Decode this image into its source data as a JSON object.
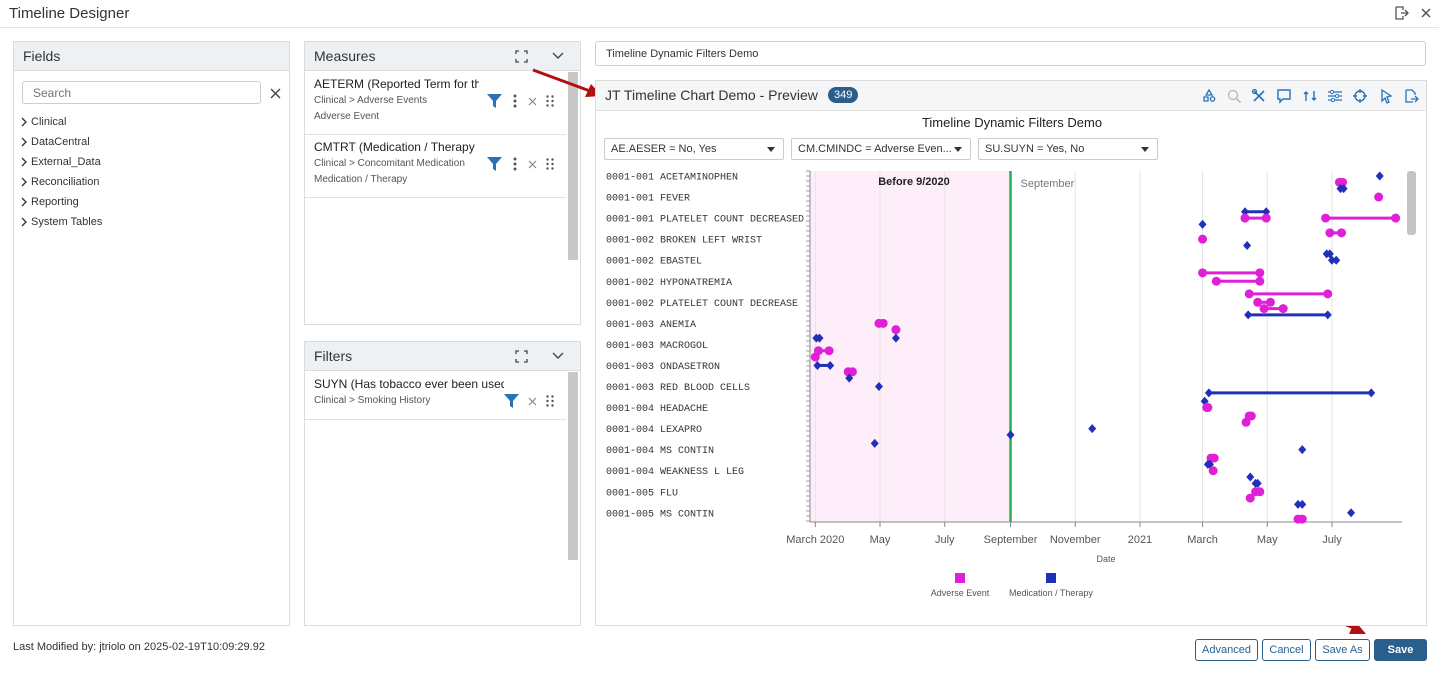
{
  "app": {
    "title": "Timeline Designer"
  },
  "fields": {
    "header": "Fields",
    "search_placeholder": "Search",
    "items": [
      "Clinical",
      "DataCentral",
      "External_Data",
      "Reconciliation",
      "Reporting",
      "System Tables"
    ]
  },
  "measures": {
    "header": "Measures",
    "items": [
      {
        "title": "AETERM (Reported Term for the A",
        "path": "Clinical > Adverse Events",
        "sub": "Adverse Event"
      },
      {
        "title": "CMTRT (Medication / Therapy Nar",
        "path": "Clinical > Concomitant Medication",
        "sub": "Medication / Therapy"
      }
    ]
  },
  "filters": {
    "header": "Filters",
    "items": [
      {
        "title": "SUYN (Has tobacco ever been used?)",
        "path": "Clinical > Smoking History"
      }
    ]
  },
  "name_value": "Timeline Dynamic Filters Demo",
  "preview": {
    "title": "JT Timeline Chart Demo - Preview",
    "count": "349"
  },
  "dropdowns": [
    "AE.AESER = No, Yes",
    "CM.CMINDC = Adverse Even...",
    "SU.SUYN = Yes, No"
  ],
  "colors": {
    "adverse": "#e020d8",
    "medication": "#2030b8",
    "band": "#fdeefa",
    "line": "#22b14c",
    "primary": "#2a5f8c"
  },
  "toolbar_icons": [
    "shapes-icon",
    "zoom-icon",
    "tools-icon",
    "comment-icon",
    "swap-icon",
    "sliders-icon",
    "crosshair-icon",
    "pointer-icon",
    "export-icon"
  ],
  "chart_data": {
    "type": "timeline",
    "title": "Timeline Dynamic Filters Demo",
    "xlabel": "Date",
    "x_ticks": [
      "March 2020",
      "May",
      "July",
      "September",
      "November",
      "2021",
      "March",
      "May",
      "July"
    ],
    "x_range": [
      "2020-02-25",
      "2021-09-05"
    ],
    "band": {
      "label": "Before 9/2020",
      "from": "2020-02-25",
      "to": "2020-09-01"
    },
    "marker": {
      "label": "September",
      "date": "2020-09-01"
    },
    "legend": [
      "Adverse Event",
      "Medication / Therapy"
    ],
    "rows": [
      "0001-001 ACETAMINOPHEN",
      "0001-001 FEVER",
      "0001-001 PLATELET COUNT DECREASED",
      "0001-002 BROKEN LEFT WRIST",
      "0001-002 EBASTEL",
      "0001-002 HYPONATREMIA",
      "0001-002 PLATELET COUNT DECREASE",
      "0001-003 ANEMIA",
      "0001-003 MACROGOL",
      "0001-003 ONDASETRON",
      "0001-003 RED BLOOD CELLS",
      "0001-004 HEADACHE",
      "0001-004 LEXAPRO",
      "0001-004 MS CONTIN",
      "0001-004 WEAKNESS L LEG",
      "0001-005 FLU",
      "0001-005 MS CONTIN"
    ],
    "events": [
      {
        "y": 0.0,
        "type": "medication",
        "start": "2021-08-15"
      },
      {
        "y": 0.3,
        "type": "adverse",
        "start": "2021-07-08",
        "end": "2021-07-11"
      },
      {
        "y": 0.6,
        "type": "medication",
        "start": "2021-07-09",
        "end": "2021-07-12"
      },
      {
        "y": 1.0,
        "type": "adverse",
        "start": "2021-08-14"
      },
      {
        "y": 1.7,
        "type": "medication",
        "start": "2021-04-10",
        "end": "2021-04-30"
      },
      {
        "y": 2.0,
        "type": "adverse",
        "start": "2021-04-10",
        "end": "2021-04-30"
      },
      {
        "y": 2.0,
        "type": "adverse",
        "start": "2021-06-25",
        "end": "2021-08-30"
      },
      {
        "y": 2.3,
        "type": "medication",
        "start": "2021-03-01"
      },
      {
        "y": 2.7,
        "type": "adverse",
        "start": "2021-06-29",
        "end": "2021-07-10"
      },
      {
        "y": 3.0,
        "type": "adverse",
        "start": "2021-03-01"
      },
      {
        "y": 3.3,
        "type": "medication",
        "start": "2021-04-12"
      },
      {
        "y": 3.7,
        "type": "medication",
        "start": "2021-06-26",
        "end": "2021-06-29"
      },
      {
        "y": 4.0,
        "type": "medication",
        "start": "2021-07-01",
        "end": "2021-07-05"
      },
      {
        "y": 4.6,
        "type": "adverse",
        "start": "2021-03-01",
        "end": "2021-04-24"
      },
      {
        "y": 5.0,
        "type": "adverse",
        "start": "2021-03-14",
        "end": "2021-04-24"
      },
      {
        "y": 5.6,
        "type": "adverse",
        "start": "2021-04-14",
        "end": "2021-06-27"
      },
      {
        "y": 6.0,
        "type": "adverse",
        "start": "2021-04-22",
        "end": "2021-05-04"
      },
      {
        "y": 6.3,
        "type": "adverse",
        "start": "2021-04-28",
        "end": "2021-05-16"
      },
      {
        "y": 6.6,
        "type": "medication",
        "start": "2021-04-13",
        "end": "2021-06-27"
      },
      {
        "y": 7.0,
        "type": "adverse",
        "start": "2020-04-30",
        "end": "2020-05-04"
      },
      {
        "y": 7.3,
        "type": "adverse",
        "start": "2020-05-16"
      },
      {
        "y": 7.7,
        "type": "medication",
        "start": "2020-03-02",
        "end": "2020-03-05"
      },
      {
        "y": 7.7,
        "type": "medication",
        "start": "2020-05-16"
      },
      {
        "y": 8.3,
        "type": "adverse",
        "start": "2020-03-04",
        "end": "2020-03-14"
      },
      {
        "y": 8.6,
        "type": "adverse",
        "start": "2020-03-01"
      },
      {
        "y": 9.0,
        "type": "medication",
        "start": "2020-03-03",
        "end": "2020-03-15"
      },
      {
        "y": 9.3,
        "type": "adverse",
        "start": "2020-04-01",
        "end": "2020-04-05"
      },
      {
        "y": 9.6,
        "type": "medication",
        "start": "2020-04-02"
      },
      {
        "y": 10.0,
        "type": "medication",
        "start": "2020-04-30"
      },
      {
        "y": 10.3,
        "type": "medication",
        "start": "2021-03-07",
        "end": "2021-08-07"
      },
      {
        "y": 10.7,
        "type": "medication",
        "start": "2021-03-03"
      },
      {
        "y": 11.0,
        "type": "adverse",
        "start": "2021-03-05",
        "end": "2021-03-06"
      },
      {
        "y": 11.4,
        "type": "adverse",
        "start": "2021-04-14",
        "end": "2021-04-16"
      },
      {
        "y": 11.7,
        "type": "adverse",
        "start": "2021-04-11"
      },
      {
        "y": 12.0,
        "type": "medication",
        "start": "2020-11-17"
      },
      {
        "y": 12.3,
        "type": "medication",
        "start": "2020-09-01"
      },
      {
        "y": 12.7,
        "type": "medication",
        "start": "2020-04-26"
      },
      {
        "y": 13.0,
        "type": "medication",
        "start": "2021-06-03"
      },
      {
        "y": 13.4,
        "type": "adverse",
        "start": "2021-03-09",
        "end": "2021-03-12"
      },
      {
        "y": 13.7,
        "type": "medication",
        "start": "2021-03-06",
        "end": "2021-03-08"
      },
      {
        "y": 14.0,
        "type": "adverse",
        "start": "2021-03-11"
      },
      {
        "y": 14.3,
        "type": "medication",
        "start": "2021-04-15"
      },
      {
        "y": 14.6,
        "type": "medication",
        "start": "2021-04-20",
        "end": "2021-04-22"
      },
      {
        "y": 15.0,
        "type": "adverse",
        "start": "2021-04-20",
        "end": "2021-04-24"
      },
      {
        "y": 15.3,
        "type": "adverse",
        "start": "2021-04-15"
      },
      {
        "y": 15.6,
        "type": "medication",
        "start": "2021-05-30",
        "end": "2021-06-03"
      },
      {
        "y": 16.0,
        "type": "medication",
        "start": "2021-07-19"
      },
      {
        "y": 16.3,
        "type": "adverse",
        "start": "2021-05-30",
        "end": "2021-06-03"
      }
    ]
  },
  "footer": {
    "last_modified": "Last Modified by: jtriolo on 2025-02-19T10:09:29.92",
    "buttons": {
      "advanced": "Advanced",
      "cancel": "Cancel",
      "save_as": "Save As",
      "save": "Save"
    }
  }
}
